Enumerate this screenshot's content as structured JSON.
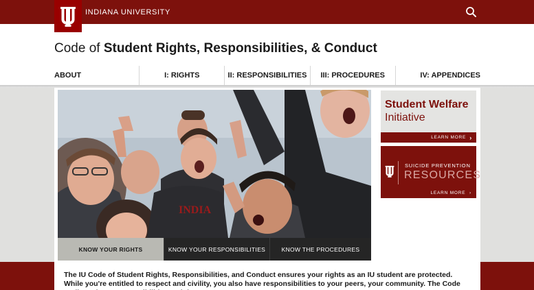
{
  "header": {
    "brand": "INDIANA UNIVERSITY",
    "logo_icon": "iu-trident-icon",
    "search_icon": "search-icon"
  },
  "site": {
    "title_prefix": "Code of",
    "title_bold": "Student Rights, Responsibilities, & Conduct"
  },
  "nav": {
    "items": [
      {
        "label": "ABOUT"
      },
      {
        "label": "I: RIGHTS"
      },
      {
        "label": "II: RESPONSIBILITIES"
      },
      {
        "label": "III: PROCEDURES"
      },
      {
        "label": "IV: APPENDICES"
      }
    ]
  },
  "hero": {
    "tabs": [
      {
        "label": "KNOW YOUR RIGHTS",
        "active": true
      },
      {
        "label": "KNOW YOUR RESPONSIBILITIES",
        "active": false
      },
      {
        "label": "KNOW THE PROCEDURES",
        "active": false
      }
    ]
  },
  "sidebar": {
    "promo1": {
      "line1": "Student Welfare",
      "line2": "Initiative",
      "cta": "LEARN MORE"
    },
    "promo2": {
      "line1": "SUICIDE PREVENTION",
      "line2": "RESOURCES",
      "cta": "LEARN MORE"
    }
  },
  "intro": {
    "text": "The IU Code of Student Rights, Responsibilities, and Conduct ensures your rights as an IU student are protected. While you're entitled to respect and civility, you also have responsibilities to your peers, your community. The Code outlines those responsibilities and the"
  },
  "colors": {
    "crimson": "#7d110c",
    "iu_red": "#990000",
    "content_grey": "#e0e0de",
    "tab_active": "#b9b9b3",
    "tab_inactive": "#252525"
  }
}
